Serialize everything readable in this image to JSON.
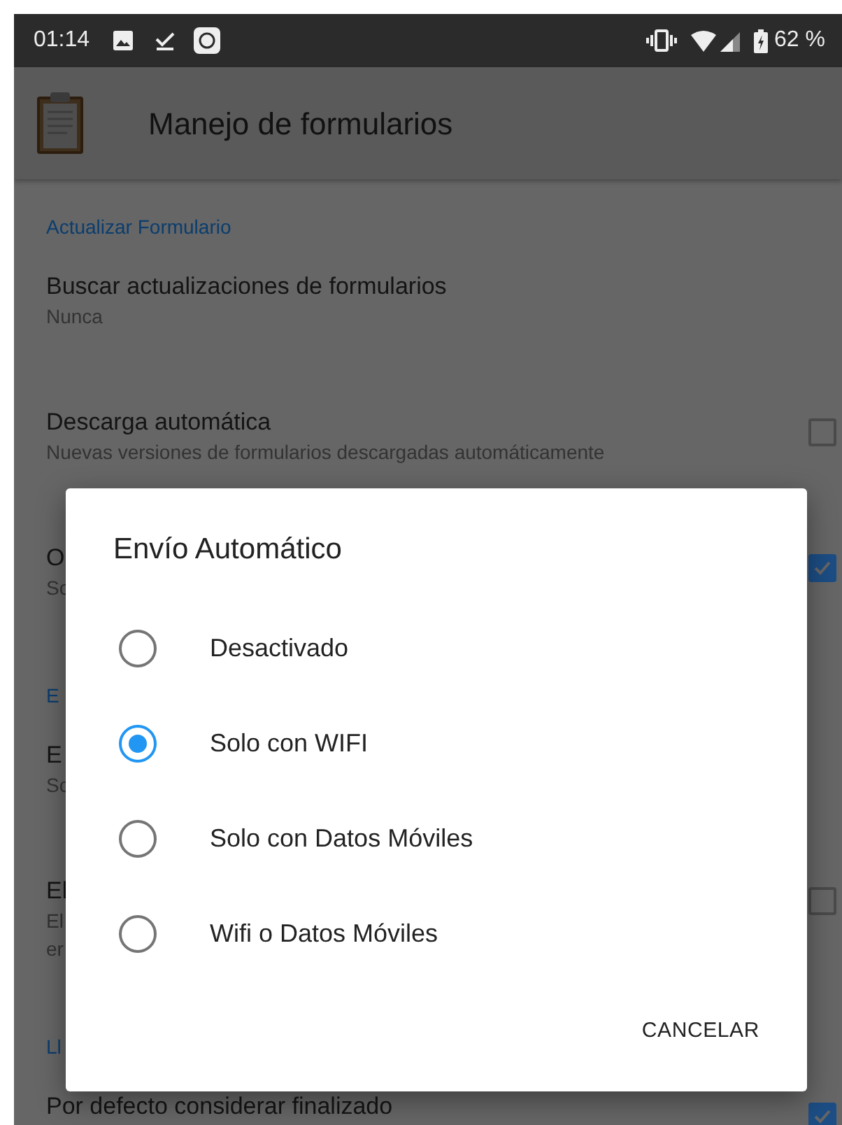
{
  "status_bar": {
    "time": "01:14",
    "battery": "62 %"
  },
  "app_bar": {
    "title": "Manejo de formularios"
  },
  "settings": [
    {
      "kind": "header",
      "title": "Actualizar Formulario"
    },
    {
      "kind": "pref",
      "title": "Buscar actualizaciones de formularios",
      "summary": [
        "Nunca"
      ]
    },
    {
      "kind": "pref",
      "title": "Descarga automática",
      "summary": [
        "Nuevas versiones de formularios descargadas automáticamente"
      ],
      "checkbox": {
        "checked": false
      }
    },
    {
      "kind": "pref",
      "title": "O",
      "summary": [
        "Sc"
      ],
      "checkbox": {
        "checked": true
      }
    },
    {
      "kind": "header",
      "title": "E"
    },
    {
      "kind": "pref",
      "title": "E",
      "summary": [
        "Sc"
      ]
    },
    {
      "kind": "pref",
      "title": "El",
      "summary": [
        "El",
        "er"
      ],
      "checkbox": {
        "checked": false
      }
    },
    {
      "kind": "header",
      "title": "Ll"
    },
    {
      "kind": "pref",
      "title": "Por defecto considerar finalizado",
      "checkbox": {
        "checked": true
      }
    }
  ],
  "dialog": {
    "title": "Envío Automático",
    "options": [
      {
        "label": "Desactivado",
        "selected": false
      },
      {
        "label": "Solo con WIFI",
        "selected": true
      },
      {
        "label": "Solo con Datos Móviles",
        "selected": false
      },
      {
        "label": "Wifi o Datos Móviles",
        "selected": false
      }
    ],
    "buttons": [
      "CANCELAR"
    ]
  }
}
